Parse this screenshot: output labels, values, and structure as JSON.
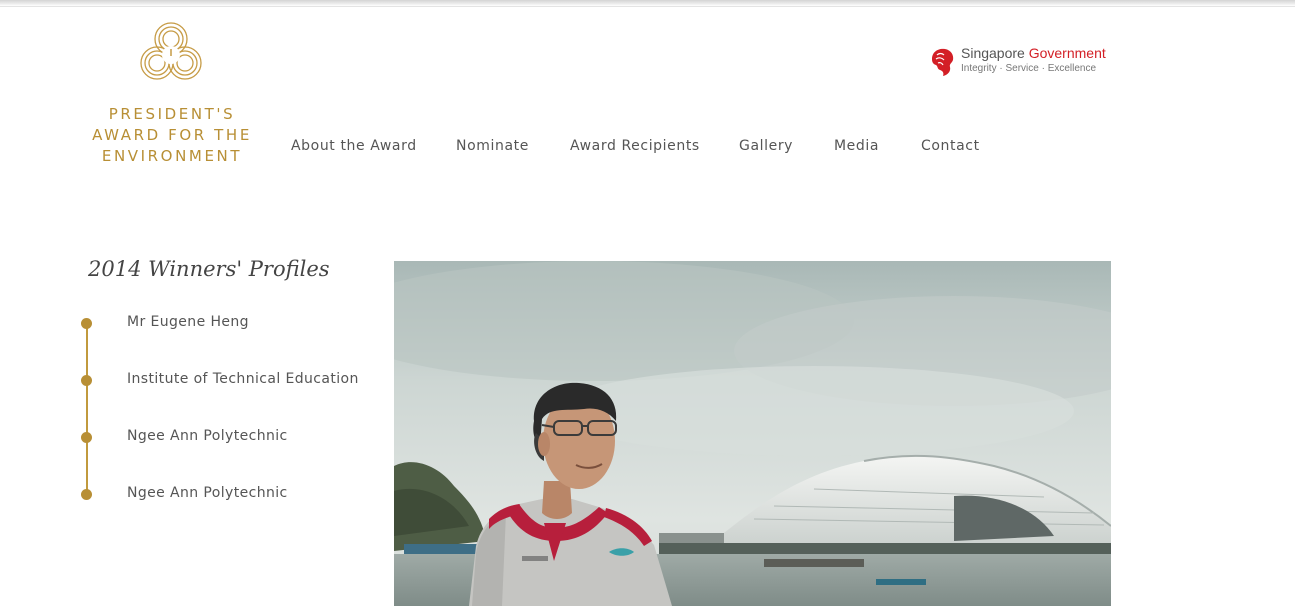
{
  "logo": {
    "line1": "PRESIDENT'S",
    "line2": "AWARD FOR THE",
    "line3": "ENVIRONMENT"
  },
  "gov": {
    "name_prefix": "Singapore ",
    "name_accent": "Government",
    "tagline": "Integrity · Service · Excellence"
  },
  "nav": {
    "items": [
      {
        "label": "About the Award"
      },
      {
        "label": "Nominate"
      },
      {
        "label": "Award Recipients"
      },
      {
        "label": "Gallery"
      },
      {
        "label": "Media"
      },
      {
        "label": "Contact"
      }
    ]
  },
  "sidebar": {
    "title": "2014 Winners' Profiles",
    "items": [
      {
        "label": "Mr Eugene Heng"
      },
      {
        "label": "Institute of Technical Education"
      },
      {
        "label": "Ngee Ann Polytechnic"
      },
      {
        "label": "Ngee Ann Polytechnic"
      }
    ]
  },
  "colors": {
    "brand_gold": "#b88f35",
    "gov_red": "#d31f26",
    "text": "#555555"
  },
  "icons": {
    "logo": "award-emblem-icon",
    "gov": "lion-head-icon"
  }
}
